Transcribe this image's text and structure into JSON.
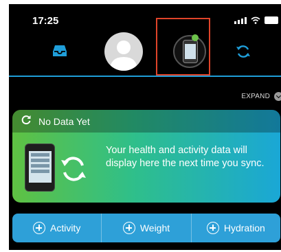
{
  "status_bar": {
    "time": "17:25",
    "icons": [
      "signal-icon",
      "wifi-icon",
      "battery-icon"
    ]
  },
  "nav": {
    "items": [
      "inbox-icon",
      "avatar",
      "device-icon",
      "sync-icon"
    ],
    "device_connected_color": "#6dc24b",
    "accent": "#1f9ed9",
    "highlight_color": "#e0442a"
  },
  "expand": {
    "label": "EXPAND"
  },
  "card": {
    "title": "No Data Yet",
    "message": "Your health and activity data will display here the next time you sync.",
    "icons": [
      "refresh-icon",
      "device-icon",
      "sync-icon"
    ]
  },
  "actions": [
    {
      "label": "Activity",
      "icon": "plus-circle-icon"
    },
    {
      "label": "Weight",
      "icon": "plus-circle-icon"
    },
    {
      "label": "Hydration",
      "icon": "plus-circle-icon"
    }
  ]
}
